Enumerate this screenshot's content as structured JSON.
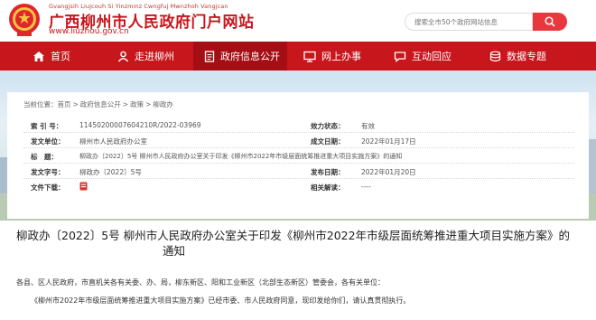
{
  "site": {
    "pinyin": "Gvangjsih Liujcouh Si Yinzminz Cwngfuj Mwnzhoh Vangjcan",
    "title": "广西柳州市人民政府门户网站",
    "url": "www.liuzhou.gov.cn"
  },
  "search": {
    "placeholder": "搜索全市50个政府网站信息"
  },
  "nav": {
    "items": [
      {
        "label": "首页",
        "icon": "home-icon"
      },
      {
        "label": "走进柳州",
        "icon": "person-icon"
      },
      {
        "label": "政府信息公开",
        "icon": "document-icon",
        "active": true
      },
      {
        "label": "网上办事",
        "icon": "monitor-icon"
      },
      {
        "label": "互动回应",
        "icon": "chat-icon"
      },
      {
        "label": "数据专题",
        "icon": "data-icon"
      }
    ]
  },
  "breadcrumb": {
    "prefix": "当前位置：",
    "items": [
      "首页",
      "政府信息公开",
      "政策",
      "柳政办"
    ],
    "separator": ">"
  },
  "info": {
    "index_label": "索 引 号：",
    "index_value": "1145020000760421­0R/2022-03969",
    "status_label": "效力状态：",
    "status_value": "有效",
    "issuer_label": "发文单位：",
    "issuer_value": "柳州市人民政府办公室",
    "date_label": "成文日期：",
    "date_value": "2022年01月17日",
    "title_label": "标　题：",
    "title_value": "柳政办〔2022〕5号 柳州市人民政府办公室关于印发《柳州市2022年市级层面统筹推进重大项目实施方案》的通知",
    "docno_label": "发文字号：",
    "docno_value": "柳政办〔2022〕5号",
    "pub_label": "发布日期：",
    "pub_value": "2022年01月20日",
    "download_label": "文件下载：",
    "attach_label": "相关解读：",
    "attach_value": "----"
  },
  "doc": {
    "title_line1": "柳政办〔2022〕5号 柳州市人民政府办公室关于印发《柳州市2022年市级层面统筹推进重大项目实施方案》的",
    "title_line2": "通知",
    "addressee": "各县、区人民政府，市直机关各有关委、办、局，柳东新区、阳和工业新区（北部生态新区）管委会，各有关单位：",
    "body1": "《柳州市2022年市级层面统筹推进重大项目实施方案》已经市委、市人民政府同意，现印发给你们，请认真贯彻执行。"
  },
  "colors": {
    "brand_red": "#c8161d",
    "nav_active": "#a50e14",
    "search_btn": "#e8383d"
  }
}
